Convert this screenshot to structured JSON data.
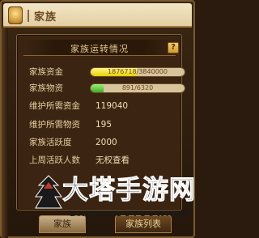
{
  "window": {
    "title": "家族"
  },
  "panel": {
    "title": "家族运转情况",
    "help_label": "?",
    "rows": [
      {
        "label": "家族资金",
        "bar_text": "1876718/3840000",
        "current": 1876718,
        "max": 3840000
      },
      {
        "label": "家族物资",
        "bar_text": "891/6320",
        "current": 891,
        "max": 6320
      },
      {
        "label": "维护所需资金",
        "value": "119040"
      },
      {
        "label": "维护所需物资",
        "value": "195"
      },
      {
        "label": "家族活跃度",
        "value": "2000"
      },
      {
        "label": "上周活跃人数",
        "value": "无权查看"
      }
    ]
  },
  "tabs": [
    {
      "label": "家族"
    },
    {
      "label": "家族列表"
    }
  ],
  "watermark": {
    "title": "大塔手游网",
    "subtitle": "DATASHOUYOUWANG"
  },
  "colors": {
    "fund_bar": "#e9d100",
    "supply_bar": "#3fae24",
    "accent": "#e7c98e"
  }
}
